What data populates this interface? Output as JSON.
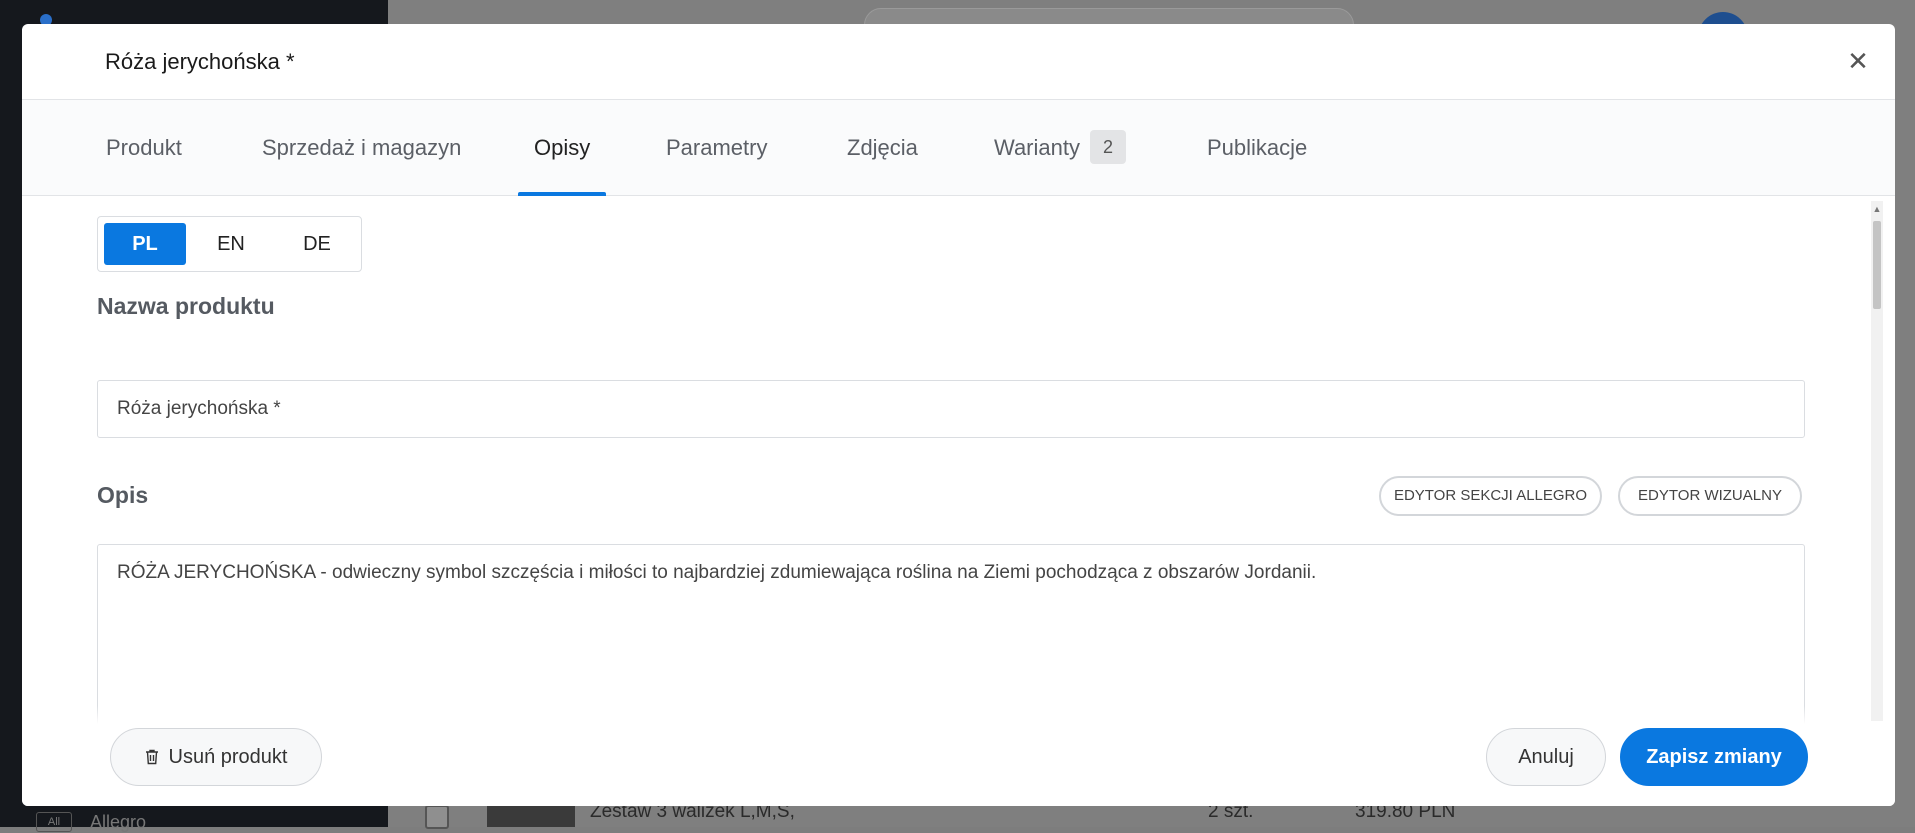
{
  "background": {
    "row": {
      "name": "Zestaw 3 walizek L,M,S,",
      "quantity": "2 szt.",
      "price": "319.80 PLN"
    },
    "sidebar_item": "Allegro",
    "sidebar_box": "All"
  },
  "modal": {
    "title": "Róża jerychońska *",
    "close_glyph": "✕"
  },
  "tabs": [
    {
      "label": "Produkt"
    },
    {
      "label": "Sprzedaż i magazyn"
    },
    {
      "label": "Opisy",
      "active": true
    },
    {
      "label": "Parametry"
    },
    {
      "label": "Zdjęcia"
    },
    {
      "label": "Warianty",
      "badge": "2"
    },
    {
      "label": "Publikacje"
    }
  ],
  "languages": [
    {
      "code": "PL",
      "active": true
    },
    {
      "code": "EN"
    },
    {
      "code": "DE"
    }
  ],
  "product_name": {
    "label": "Nazwa produktu",
    "value": "Róża jerychońska *"
  },
  "description": {
    "label": "Opis",
    "allegro_editor_label": "EDYTOR SEKCJI ALLEGRO",
    "visual_editor_label": "EDYTOR WIZUALNY",
    "text": "RÓŻA JERYCHOŃSKA - odwieczny symbol szczęścia i miłości to najbardziej zdumiewająca roślina na Ziemi pochodząca z obszarów Jordanii."
  },
  "footer": {
    "delete_label": "Usuń produkt",
    "cancel_label": "Anuluj",
    "save_label": "Zapisz zmiany"
  },
  "colors": {
    "accent": "#0a78e0",
    "overlay": "#7f7f7f",
    "sidebar": "#15181d"
  },
  "icons": {
    "close": "close-icon",
    "delete": "trash-icon",
    "scroll_up": "chevron-up-icon"
  }
}
